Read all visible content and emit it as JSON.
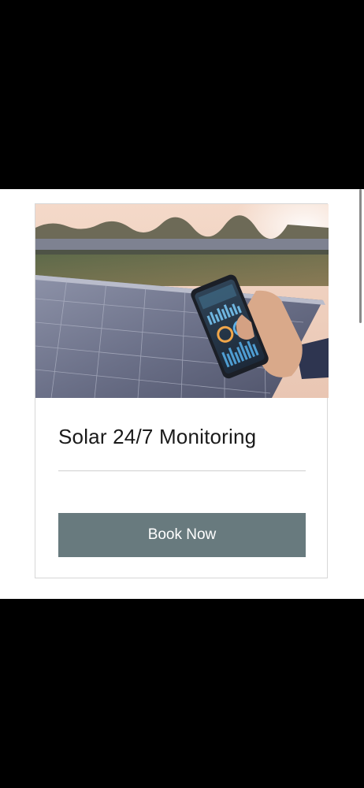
{
  "card": {
    "image_alt": "Hand holding a smartphone displaying a solar monitoring dashboard in front of solar panels",
    "title": "Solar 24/7 Monitoring",
    "button_label": "Book Now"
  },
  "colors": {
    "background": "#000000",
    "page": "#ffffff",
    "card_border": "#d7d7d7",
    "button": "#687a7e",
    "button_text": "#ffffff",
    "title_text": "#1a1a1a"
  }
}
